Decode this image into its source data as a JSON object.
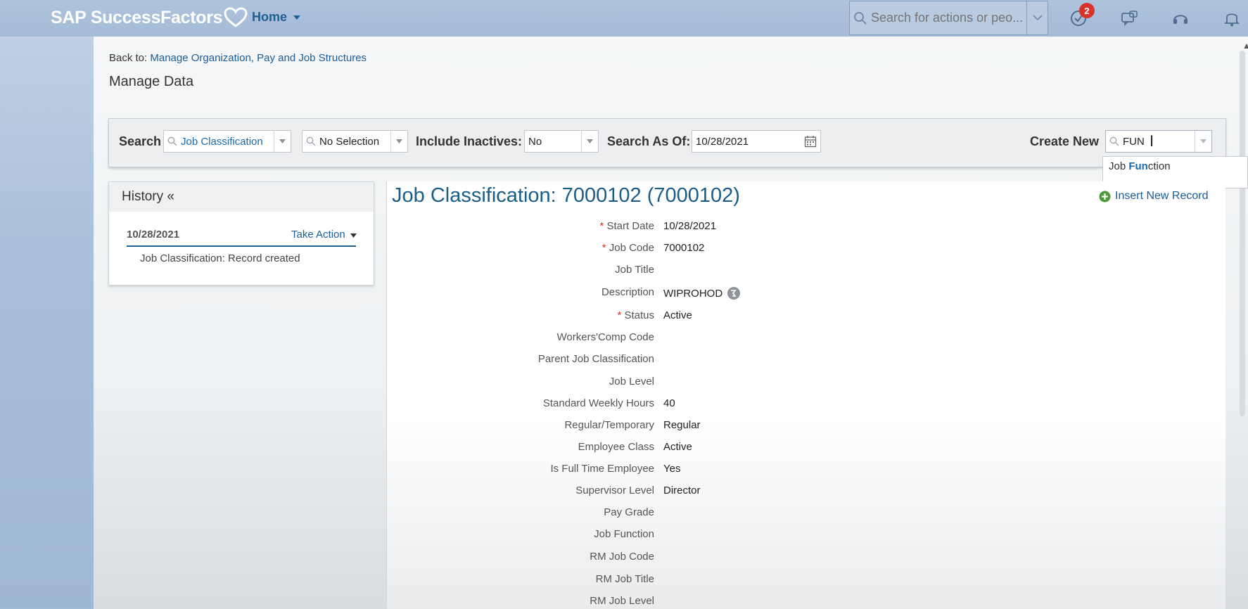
{
  "shell": {
    "brand": "SAP SuccessFactors",
    "home_label": "Home",
    "search_placeholder": "Search for actions or peo...",
    "notification_count": "2",
    "accent": "#1f5f94"
  },
  "breadcrumb": {
    "prefix": "Back to:",
    "link": "Manage Organization, Pay and Job Structures"
  },
  "page_title": "Manage Data",
  "filters": {
    "search_label": "Search",
    "search_value": "Job Classification",
    "secondary_value": "No Selection",
    "include_inactives_label": "Include Inactives:",
    "include_inactives_value": "No",
    "search_as_of_label": "Search As Of:",
    "search_as_of_value": "10/28/2021",
    "create_new_label": "Create New",
    "create_new_value": "FUN"
  },
  "suggestion": {
    "prefix": "Job ",
    "match": "Fun",
    "suffix": "ction"
  },
  "history": {
    "title": "History «",
    "date": "10/28/2021",
    "take_action": "Take Action",
    "entry": "Job Classification: Record created"
  },
  "record": {
    "title": "Job Classification: 7000102 (7000102)",
    "insert_label": "Insert New Record",
    "fields": [
      {
        "label": "Start Date",
        "required": true,
        "value": "10/28/2021"
      },
      {
        "label": "Job Code",
        "required": true,
        "value": "7000102"
      },
      {
        "label": "Job Title",
        "required": false,
        "value": ""
      },
      {
        "label": "Description",
        "required": false,
        "value": "WIPROHOD"
      },
      {
        "label": "Status",
        "required": true,
        "value": "Active"
      },
      {
        "label": "Workers'Comp Code",
        "required": false,
        "value": ""
      },
      {
        "label": "Parent Job Classification",
        "required": false,
        "value": ""
      },
      {
        "label": "Job Level",
        "required": false,
        "value": ""
      },
      {
        "label": "Standard Weekly Hours",
        "required": false,
        "value": "40"
      },
      {
        "label": "Regular/Temporary",
        "required": false,
        "value": "Regular"
      },
      {
        "label": "Employee Class",
        "required": false,
        "value": "Active"
      },
      {
        "label": "Is Full Time Employee",
        "required": false,
        "value": "Yes"
      },
      {
        "label": "Supervisor Level",
        "required": false,
        "value": "Director"
      },
      {
        "label": "Pay Grade",
        "required": false,
        "value": ""
      },
      {
        "label": "Job Function",
        "required": false,
        "value": ""
      },
      {
        "label": "RM Job Code",
        "required": false,
        "value": ""
      },
      {
        "label": "RM Job Title",
        "required": false,
        "value": ""
      },
      {
        "label": "RM Job Level",
        "required": false,
        "value": ""
      }
    ]
  }
}
